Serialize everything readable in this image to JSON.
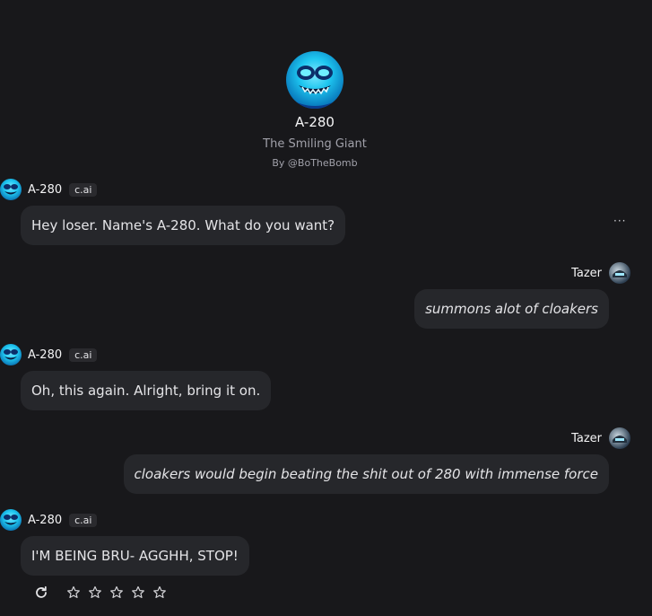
{
  "character": {
    "name": "A-280",
    "tagline": "The Smiling Giant",
    "author": "By @BoTheBomb"
  },
  "messages": [
    {
      "sender": "bot",
      "name": "A-280",
      "badge": "c.ai",
      "text": "Hey loser. Name's A-280. What do you want?"
    },
    {
      "sender": "user",
      "name": "Tazer",
      "text": "summons alot of cloakers"
    },
    {
      "sender": "bot",
      "name": "A-280",
      "badge": "c.ai",
      "text": "Oh, this again. Alright, bring it on."
    },
    {
      "sender": "user",
      "name": "Tazer",
      "text": "cloakers would begin beating the shit out of 280 with immense force"
    },
    {
      "sender": "bot",
      "name": "A-280",
      "badge": "c.ai",
      "text": "I'M BEING BRU- AGGHH, STOP!"
    }
  ],
  "more_menu": "···",
  "rating": {
    "stars": 5,
    "filled": 0
  },
  "icons": {
    "regenerate": "refresh-icon",
    "star": "star-icon",
    "more": "more-icon"
  },
  "colors": {
    "background": "#18181b",
    "bubble": "#26272b",
    "text": "#e4e4e7",
    "muted": "#a1a1aa"
  }
}
